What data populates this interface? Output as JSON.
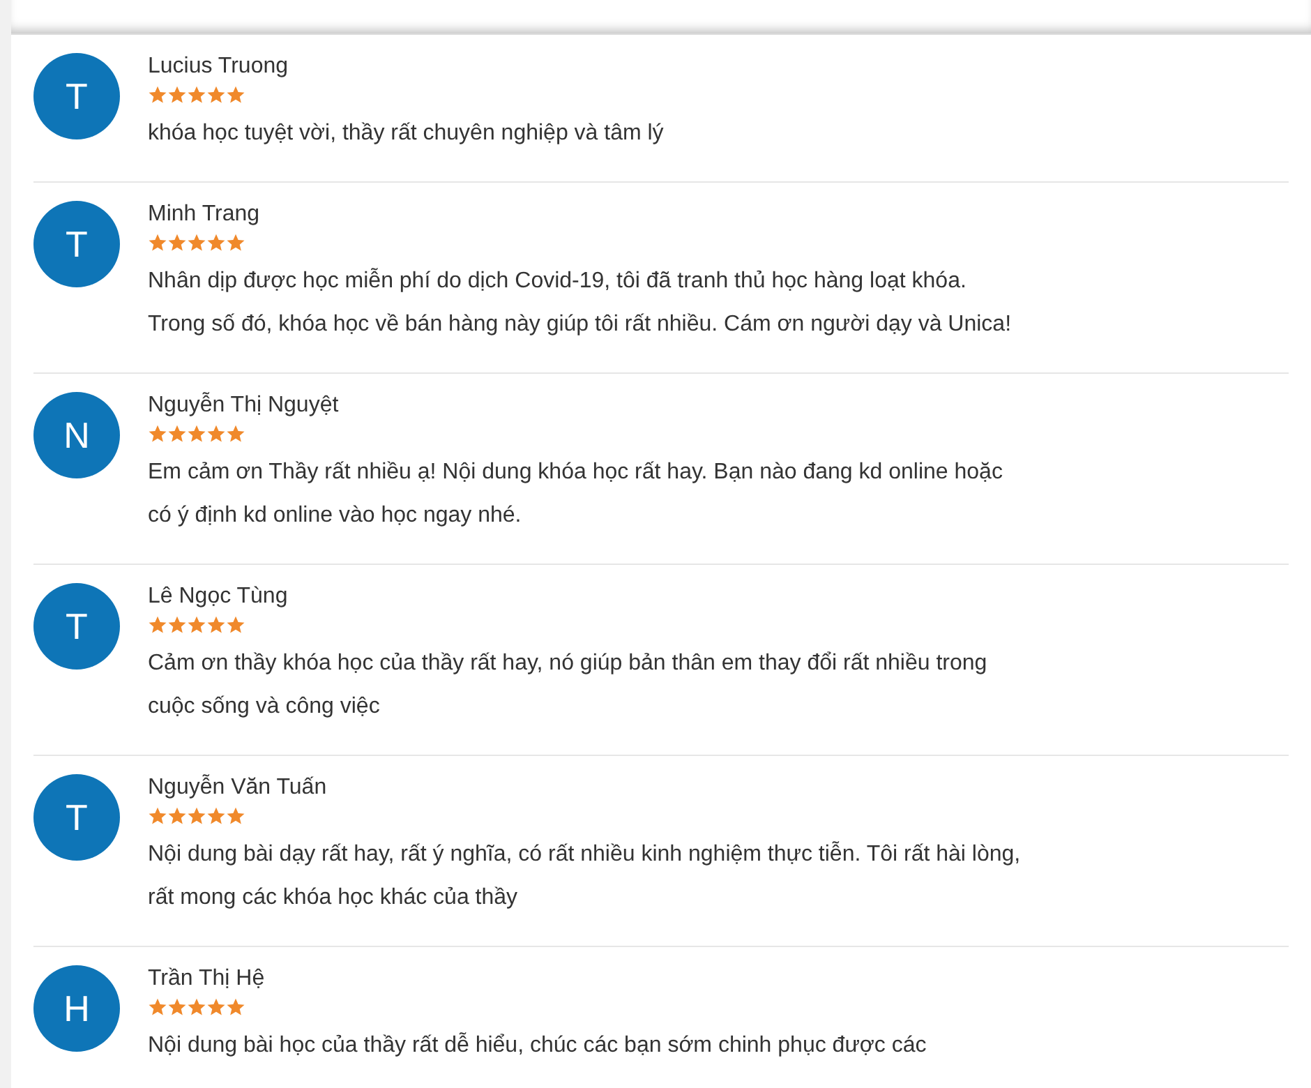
{
  "reviews": [
    {
      "initial": "T",
      "name": "Lucius Truong",
      "stars": 5,
      "text": "khóa học tuyệt vời, thầy rất chuyên nghiệp và tâm lý"
    },
    {
      "initial": "T",
      "name": "Minh Trang",
      "stars": 5,
      "text": "Nhân dịp được học miễn phí do dịch Covid-19, tôi đã tranh thủ học hàng loạt khóa. Trong số đó, khóa học về bán hàng này giúp tôi rất nhiều. Cám ơn người dạy và Unica!"
    },
    {
      "initial": "N",
      "name": "Nguyễn Thị Nguyệt",
      "stars": 5,
      "text": "Em cảm ơn Thầy rất nhiều ạ! Nội dung khóa học rất hay. Bạn nào đang kd online hoặc có ý định kd online vào học ngay nhé."
    },
    {
      "initial": "T",
      "name": "Lê Ngọc Tùng",
      "stars": 5,
      "text": "Cảm ơn thầy khóa học của thầy rất hay, nó giúp bản thân em thay đổi rất nhiều trong cuộc sống và công việc"
    },
    {
      "initial": "T",
      "name": "Nguyễn Văn Tuấn",
      "stars": 5,
      "text": "Nội dung bài dạy rất hay, rất ý nghĩa, có rất nhiều kinh nghiệm thực tiễn. Tôi rất hài lòng, rất mong các khóa học khác của thầy"
    },
    {
      "initial": "H",
      "name": "Trần Thị Hệ",
      "stars": 5,
      "text": "Nội dung bài học của thầy rất dễ hiểu, chúc các bạn sớm chinh phục được các"
    }
  ]
}
